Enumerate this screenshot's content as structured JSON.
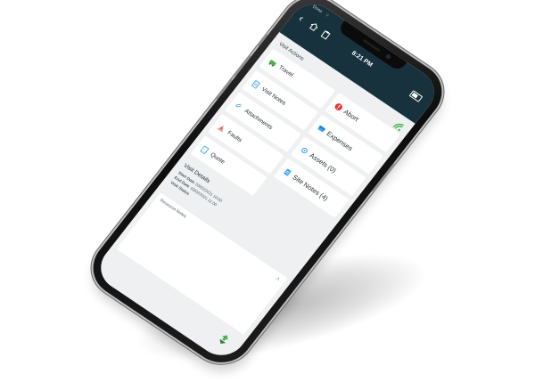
{
  "status_bar": {
    "carrier": "Done",
    "time": "8:21 PM"
  },
  "header": {
    "back": "‹"
  },
  "visit_actions": {
    "title": "Visit Actions",
    "tiles": [
      {
        "label": "Travel",
        "icon": "travel-icon"
      },
      {
        "label": "Abort",
        "icon": "abort-alert-icon"
      },
      {
        "label": "Visit Notes",
        "icon": "notes-icon"
      },
      {
        "label": "Expenses",
        "icon": "expenses-icon"
      },
      {
        "label": "Attachments",
        "icon": "attachment-icon"
      },
      {
        "label": "Assets (0)",
        "icon": "assets-icon"
      },
      {
        "label": "Faults",
        "icon": "fault-icon"
      },
      {
        "label": "Site Notes (4)",
        "icon": "site-notes-icon"
      },
      {
        "label": "Quote",
        "icon": "quote-icon"
      }
    ]
  },
  "visit_details": {
    "title": "Visit Details",
    "rows": [
      {
        "key": "Start Date",
        "value": "03/02/2021 10:00"
      },
      {
        "key": "End Date",
        "value": "03/02/2021 11:00"
      },
      {
        "key": "Visit Status",
        "value": ""
      }
    ]
  },
  "notes": {
    "label": "Resource Notes"
  },
  "colors": {
    "header": "#17313d",
    "accent_green": "#4caf50",
    "alert_red": "#e53935",
    "icon_blue": "#42a5f5"
  }
}
